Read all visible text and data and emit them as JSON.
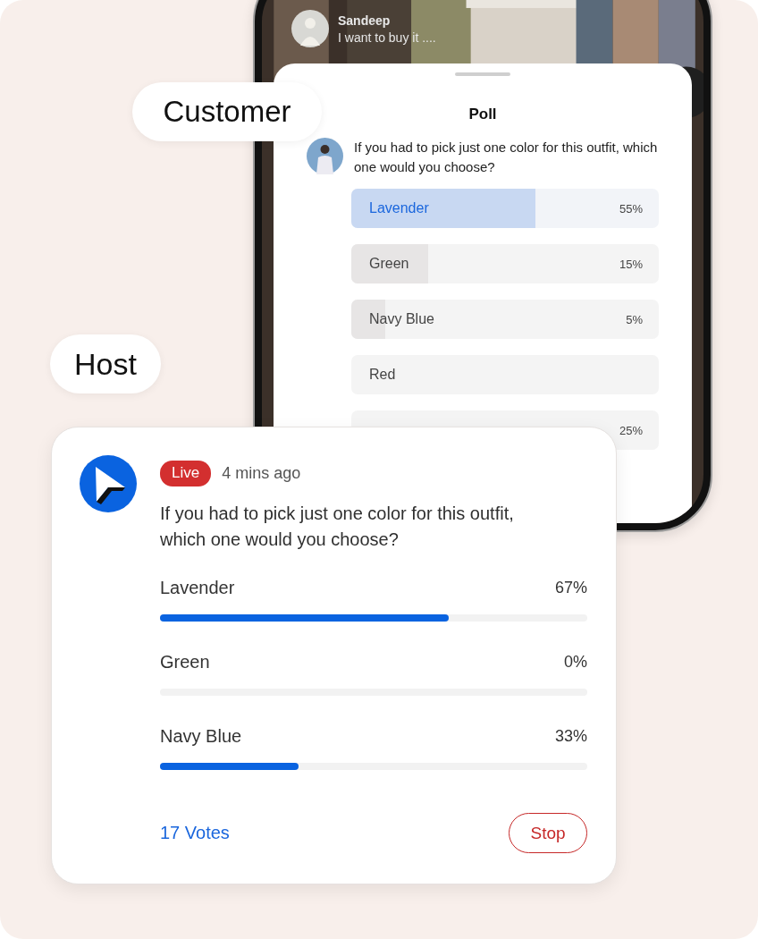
{
  "customer_label": "Customer",
  "host_label": "Host",
  "stream": {
    "commenter": "Sandeep",
    "comment": "I want to buy it ...."
  },
  "poll": {
    "title": "Poll",
    "question": "If you had to pick just one color for this outfit, which one would you choose?",
    "options": [
      {
        "label": "Lavender",
        "percent": "55%",
        "level": 0.6,
        "selected": true
      },
      {
        "label": "Green",
        "percent": "15%",
        "level": 0.25,
        "selected": false
      },
      {
        "label": "Navy Blue",
        "percent": "5%",
        "level": 0.11,
        "selected": false
      },
      {
        "label": "Red",
        "selected": false
      },
      {
        "percent": "25%"
      }
    ]
  },
  "host_card": {
    "badge": "Live",
    "time": "4 mins ago",
    "question": "If you had to pick just one color for this outfit, which one would you choose?",
    "options": [
      {
        "label": "Lavender",
        "percent": "67%",
        "level": 0.675
      },
      {
        "label": "Green",
        "percent": "0%",
        "level": 0
      },
      {
        "label": "Navy Blue",
        "percent": "33%",
        "level": 0.325
      }
    ],
    "votes": "17 Votes",
    "stop": "Stop"
  }
}
